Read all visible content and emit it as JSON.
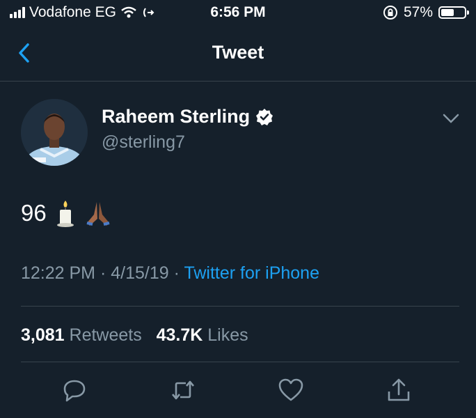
{
  "status_bar": {
    "carrier": "Vodafone EG",
    "time": "6:56 PM",
    "battery_percent": "57%",
    "battery_level": 0.57
  },
  "nav": {
    "title": "Tweet",
    "back_icon": "chevron-left-icon"
  },
  "tweet": {
    "author_name": "Raheem Sterling",
    "author_handle": "@sterling7",
    "verified": true,
    "text": "96",
    "emojis": [
      "candle",
      "folded-hands"
    ],
    "time": "12:22 PM",
    "date": "4/15/19",
    "separator": "·",
    "source": "Twitter for iPhone",
    "retweets_count": "3,081",
    "retweets_label": "Retweets",
    "likes_count": "43.7K",
    "likes_label": "Likes"
  },
  "actions": [
    {
      "name": "reply",
      "icon": "reply-icon"
    },
    {
      "name": "retweet",
      "icon": "retweet-icon"
    },
    {
      "name": "like",
      "icon": "heart-icon"
    },
    {
      "name": "share",
      "icon": "share-icon"
    }
  ],
  "colors": {
    "background": "#15202b",
    "accent": "#1da1f2",
    "secondary_text": "#8899a6",
    "divider": "#38444d"
  }
}
